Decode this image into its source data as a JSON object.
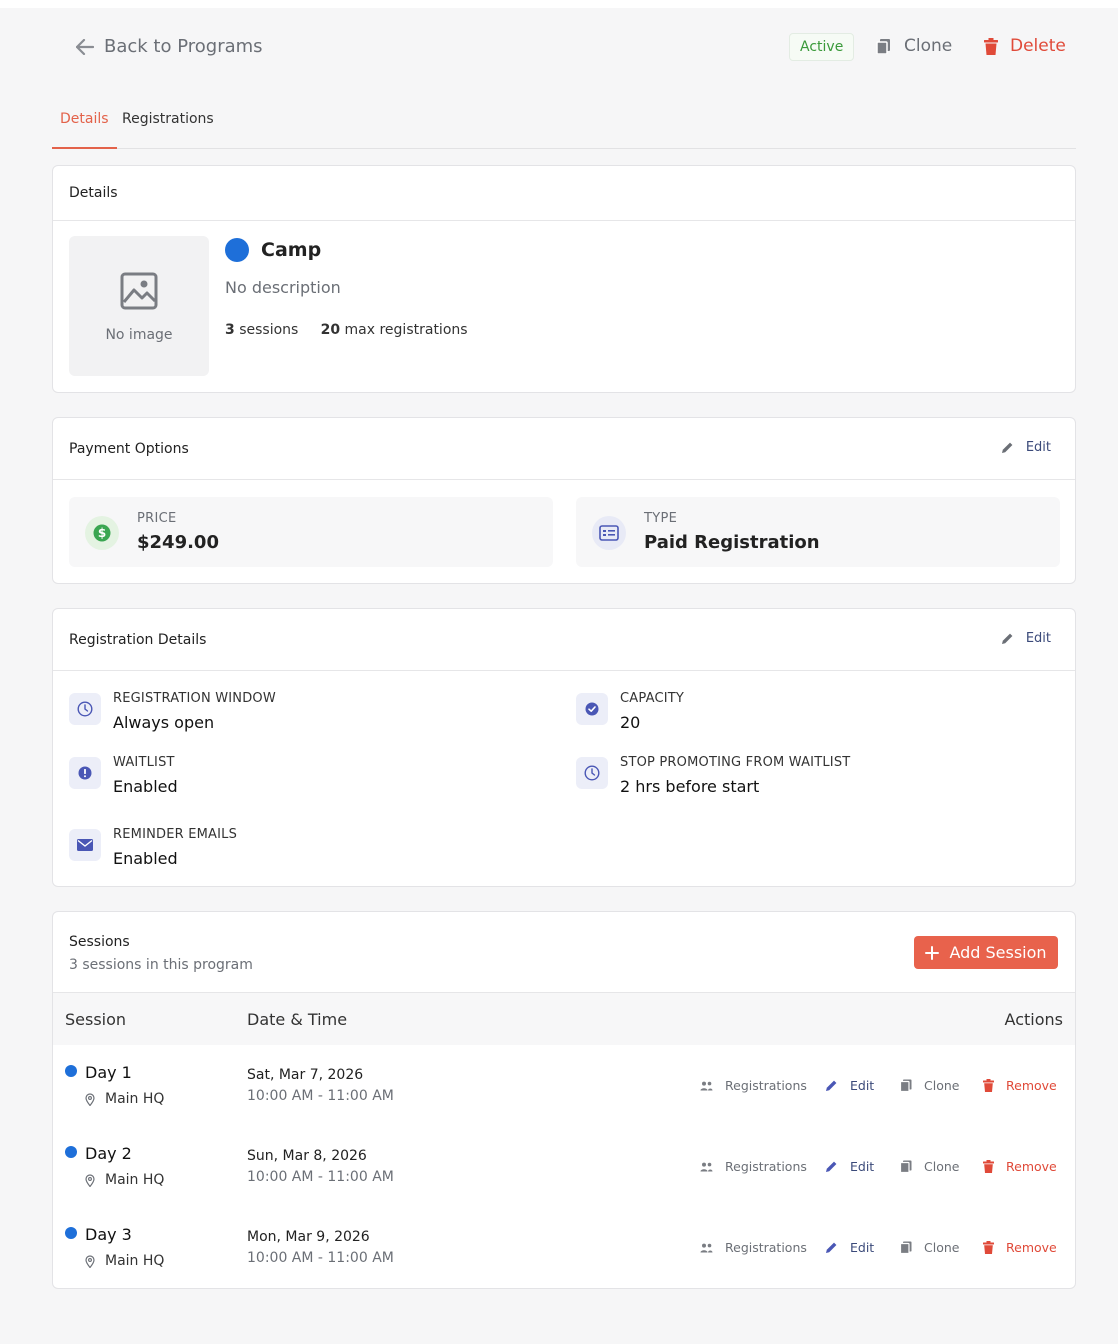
{
  "header": {
    "back_label": "Back to Programs",
    "status": "Active",
    "clone_label": "Clone",
    "delete_label": "Delete"
  },
  "tabs": [
    {
      "label": "Details",
      "active": true
    },
    {
      "label": "Registrations",
      "active": false
    }
  ],
  "details": {
    "title": "Details",
    "no_image_label": "No image",
    "program_name": "Camp",
    "program_color": "#1e6fd9",
    "description": "No description",
    "sessions_count": "3",
    "sessions_label": "sessions",
    "max_registrations": "20",
    "max_registrations_label": "max registrations"
  },
  "payment": {
    "title": "Payment Options",
    "edit_label": "Edit",
    "price_label": "PRICE",
    "price_value": "$249.00",
    "type_label": "TYPE",
    "type_value": "Paid Registration"
  },
  "registration_details": {
    "title": "Registration Details",
    "edit_label": "Edit",
    "items": [
      {
        "label": "REGISTRATION WINDOW",
        "value": "Always open",
        "icon": "clock-icon"
      },
      {
        "label": "CAPACITY",
        "value": "20",
        "icon": "check-circle-icon"
      },
      {
        "label": "WAITLIST",
        "value": "Enabled",
        "icon": "exclamation-circle-icon"
      },
      {
        "label": "STOP PROMOTING FROM WAITLIST",
        "value": "2 hrs before start",
        "icon": "clock-icon"
      },
      {
        "label": "REMINDER EMAILS",
        "value": "Enabled",
        "icon": "envelope-icon"
      }
    ]
  },
  "sessions": {
    "title": "Sessions",
    "subtitle": "3 sessions in this program",
    "add_label": "Add Session",
    "columns": {
      "session": "Session",
      "datetime": "Date & Time",
      "actions": "Actions"
    },
    "action_labels": {
      "registrations": "Registrations",
      "edit": "Edit",
      "clone": "Clone",
      "remove": "Remove"
    },
    "rows": [
      {
        "name": "Day 1",
        "location": "Main HQ",
        "date": "Sat, Mar 7, 2026",
        "time": "10:00 AM - 11:00 AM"
      },
      {
        "name": "Day 2",
        "location": "Main HQ",
        "date": "Sun, Mar 8, 2026",
        "time": "10:00 AM - 11:00 AM"
      },
      {
        "name": "Day 3",
        "location": "Main HQ",
        "date": "Mon, Mar 9, 2026",
        "time": "10:00 AM - 11:00 AM"
      }
    ]
  },
  "colors": {
    "accent": "#e8624c",
    "session_dot": "#1e6fd9",
    "active_status": "#3a9a3a",
    "danger": "#e04a39"
  }
}
